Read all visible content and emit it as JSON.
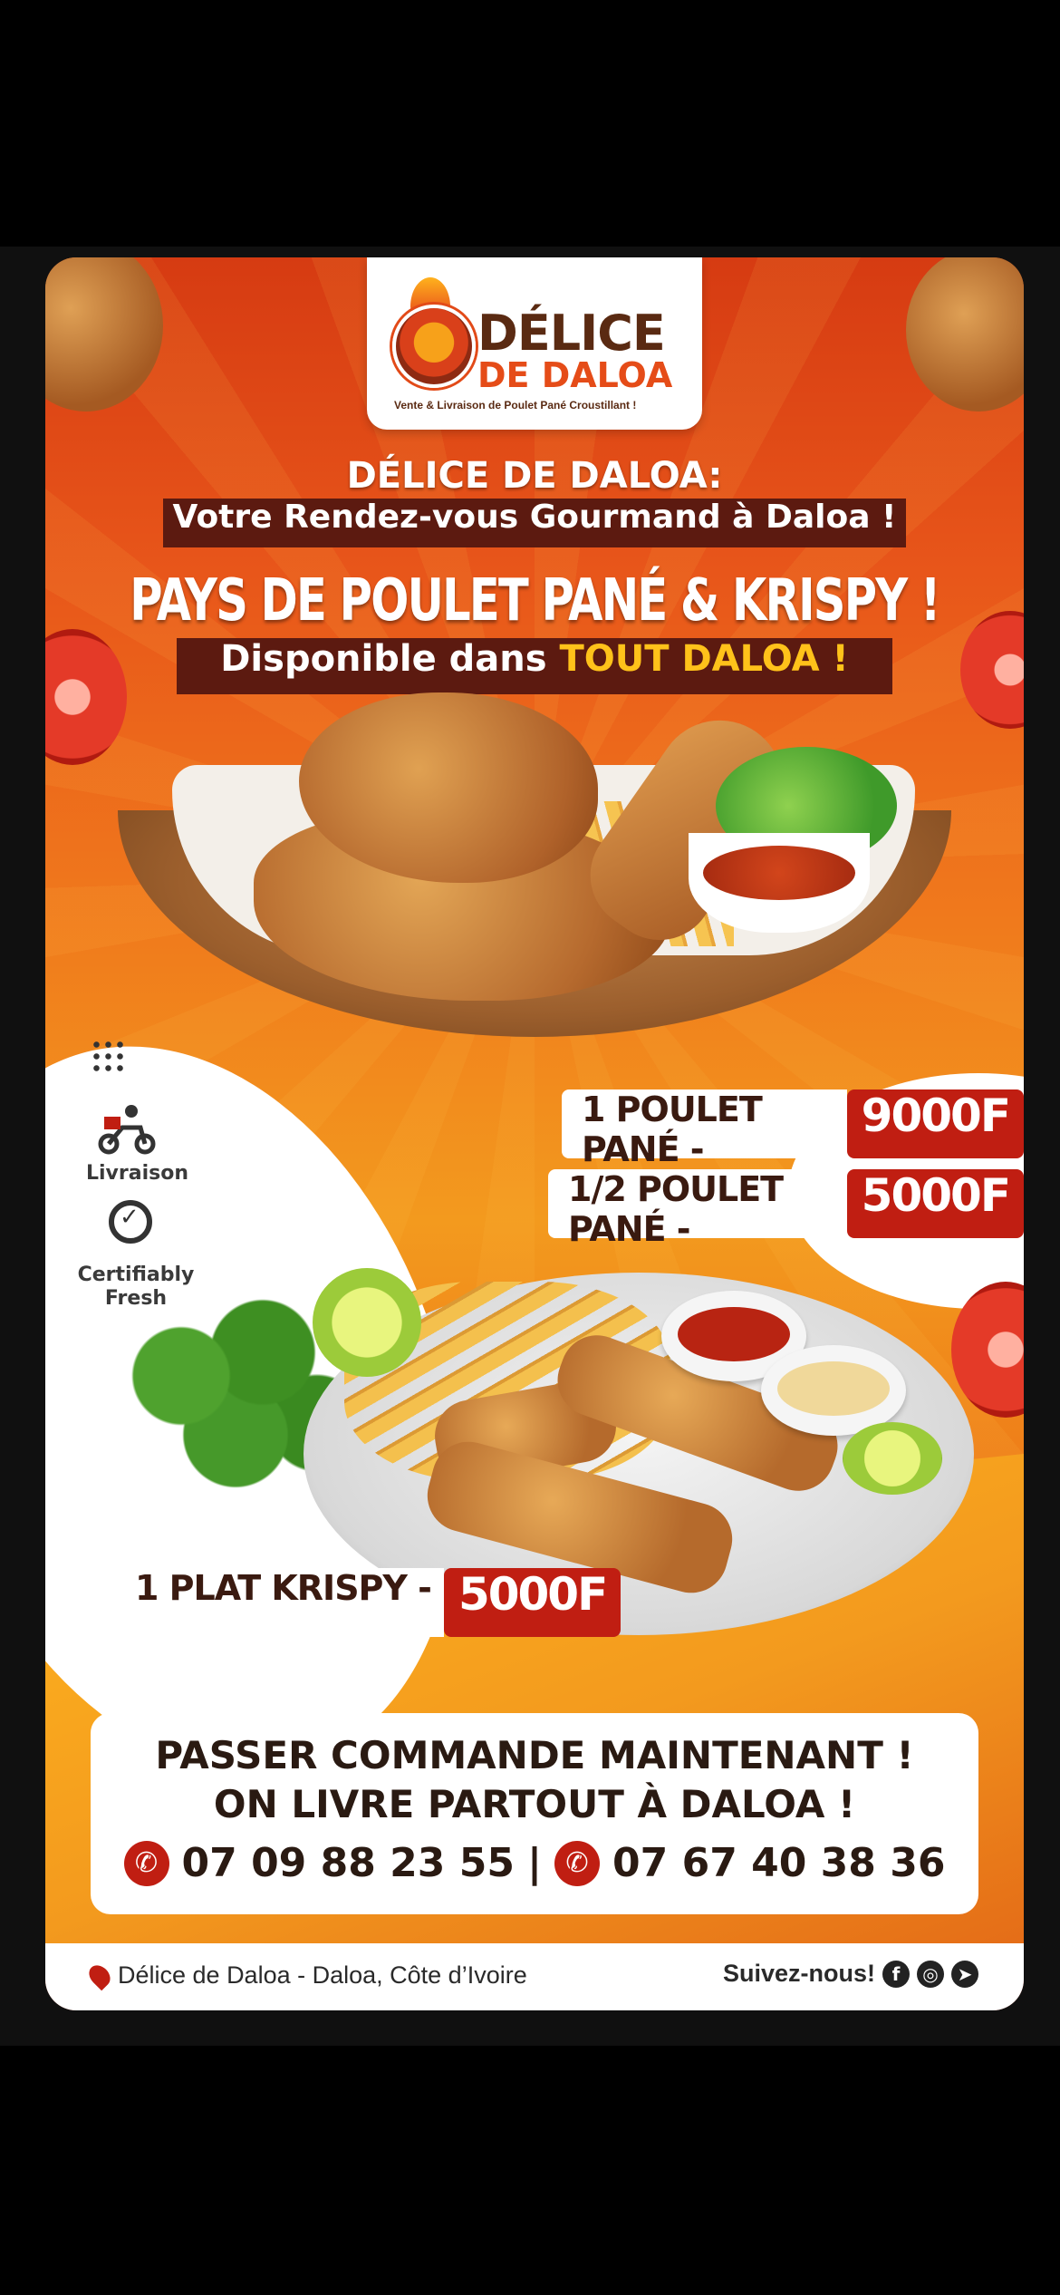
{
  "logo": {
    "title_line1": "DÉLICE",
    "title_line2": "DE DALOA",
    "tagline": "Vente & Livraison de Poulet Pané Croustillant !"
  },
  "header": {
    "subtitle_line1": "DÉLICE DE DALOA:",
    "subtitle_line2": "Votre Rendez-vous Gourmand à Daloa !",
    "headline": "PAYS DE POULET PANÉ & KRISPY !",
    "availability_prefix": "Disponible dans",
    "availability_highlight": "TOUT DALOA !"
  },
  "badges": {
    "delivery": "Livraison",
    "fresh": "Certifiably Fresh"
  },
  "prices": [
    {
      "label": "1 POULET PANÉ -",
      "value": "9000F"
    },
    {
      "label": "1/2 POULET PANÉ -",
      "value": "5000F"
    },
    {
      "label": "1 PLAT KRISPY -",
      "value": "5000F"
    }
  ],
  "cta": {
    "line1": "PASSER COMMANDE MAINTENANT !",
    "line2": "ON LIVRE PARTOUT À DALOA !",
    "phone1": "07 09 88 23 55",
    "separator": "|",
    "phone2": "07 67 40 38 36"
  },
  "footer": {
    "location": "Délice de Daloa - Daloa, Côte d’Ivoire",
    "follow": "Suivez-nous!"
  },
  "icons": [
    "flame-icon",
    "scooter-icon",
    "certified-icon",
    "phone-icon",
    "location-pin-icon",
    "facebook-icon",
    "instagram-icon",
    "telegram-icon"
  ],
  "colors": {
    "accent_red": "#c01e12",
    "dark_band": "#5c1a10",
    "highlight_yellow": "#ffc21a"
  }
}
